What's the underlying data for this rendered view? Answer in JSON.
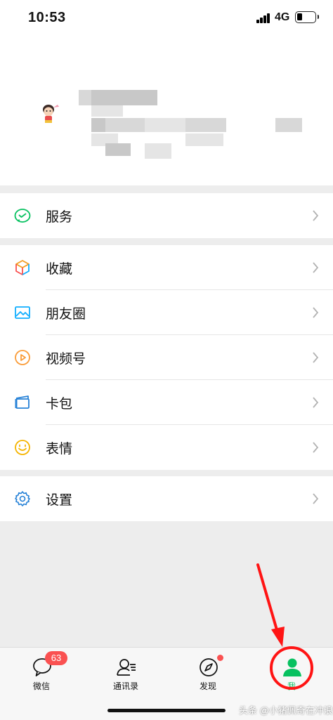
{
  "status_bar": {
    "time": "10:53",
    "network": "4G"
  },
  "menu": {
    "service": {
      "label": "服务",
      "icon": "wechat-pay-icon"
    },
    "favorites": {
      "label": "收藏",
      "icon": "cube-icon"
    },
    "moments": {
      "label": "朋友圈",
      "icon": "image-icon"
    },
    "channels": {
      "label": "视频号",
      "icon": "play-icon"
    },
    "cards": {
      "label": "卡包",
      "icon": "wallet-icon"
    },
    "stickers": {
      "label": "表情",
      "icon": "smile-icon"
    },
    "settings": {
      "label": "设置",
      "icon": "gear-icon"
    }
  },
  "tabbar": {
    "chats": {
      "label": "微信",
      "badge": "63"
    },
    "contacts": {
      "label": "通讯录"
    },
    "discover": {
      "label": "发现"
    },
    "me": {
      "label": "我"
    }
  },
  "watermark": "头条 @小猪佩奇在冲浪",
  "colors": {
    "accent": "#07c160",
    "badge": "#fa5151",
    "annotation": "#ff1414",
    "background": "#ededed"
  }
}
